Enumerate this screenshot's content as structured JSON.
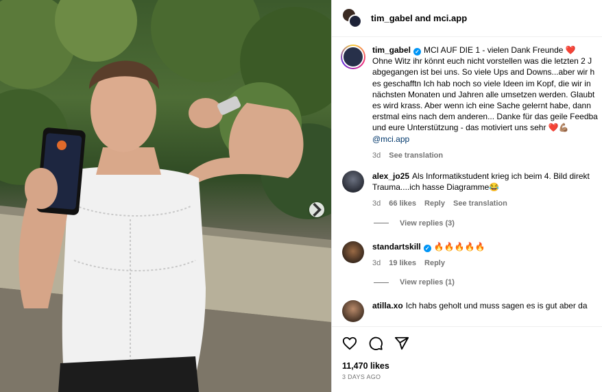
{
  "header": {
    "title": "tim_gabel and mci.app"
  },
  "caption": {
    "username": "tim_gabel",
    "lines": [
      "MCI AUF DIE 1 - vielen Dank Freunde ❤️",
      "Ohne Witz ihr könnt euch nicht vorstellen was die letzten 2 J",
      "abgegangen ist bei uns. So viele Ups and Downs...aber wir h",
      "es geschafftn Ich hab noch so viele Ideen im Kopf, die wir in",
      "nächsten Monaten und Jahren alle umsetzen werden. Glaubt",
      "es wird krass. Aber wenn ich eine Sache gelernt habe, dann",
      "erstmal eins nach dem anderen... Danke für das geile Feedba",
      "und eure Unterstützung - das motiviert uns sehr ❤️💪🏽"
    ],
    "mention": "@mci.app",
    "time": "3d",
    "see_translation": "See translation"
  },
  "comments": [
    {
      "username": "alex_jo25",
      "text": "Als Informatikstudent krieg ich beim 4. Bild direkt",
      "text2": "Trauma....ich hasse Diagramme😂",
      "time": "3d",
      "likes": "66 likes",
      "reply": "Reply",
      "see_translation": "See translation",
      "view_replies": "View replies (3)"
    },
    {
      "username": "standartskill",
      "text": "🔥🔥🔥🔥🔥",
      "time": "3d",
      "likes": "19 likes",
      "reply": "Reply",
      "view_replies": "View replies (1)"
    },
    {
      "username": "atilla.xo",
      "text": "Ich habs geholt und muss sagen es is gut aber da"
    }
  ],
  "actions": {
    "like_icon": "heart-icon",
    "comment_icon": "comment-icon",
    "share_icon": "share-icon"
  },
  "footer": {
    "likes": "11,470 likes",
    "date": "3 DAYS AGO"
  },
  "colors": {
    "link": "#00376b",
    "verified": "#0095f6",
    "muted": "#737373"
  }
}
